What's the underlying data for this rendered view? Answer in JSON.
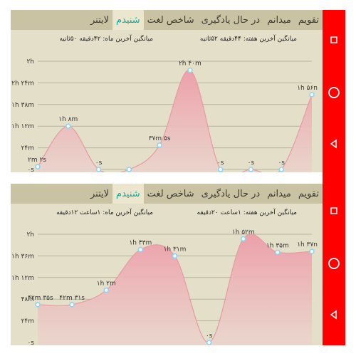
{
  "tabs": [
    "تقویم",
    "میدانم",
    "در حال یادگیری",
    "شاخص لغت",
    "شنیدم",
    "لایتنر"
  ],
  "active_tab": "شنیدم",
  "screens": [
    {
      "avg_week": "میانگین آخرین هفته: ۴۴دقیقه ۵۲ثانیه",
      "avg_month": "میانگین آخرین ماه: ۴۲دقیقه ۵۰ثانیه"
    },
    {
      "avg_week": "میانگین آخرین هفته: ۱ساعت ۲۰دقیقه",
      "avg_month": "میانگین آخرین ماه: ۱ساعت ۱۲دقیقه"
    }
  ],
  "nav": {
    "icons": [
      "recents-square-icon",
      "home-circle-icon",
      "back-triangle-icon"
    ]
  },
  "colors": {
    "accent": "#1aa89b",
    "nav_bar": "#ff0000",
    "fill": "#f2a3ad",
    "point": "#8fd3f5"
  },
  "chart_data": [
    {
      "type": "area",
      "ylim": [
        0,
        120
      ],
      "y_unit": "minutes",
      "yticks": [
        0,
        24,
        48,
        72,
        96,
        120
      ],
      "ytick_labels": [
        "۰s",
        "۲۴m",
        "۱h ۱۲m",
        "۱h ۳۸m",
        "۲h ۲۴m",
        "۲h"
      ],
      "values": [
        3,
        48,
        0,
        0,
        27,
        110,
        0,
        0,
        0,
        83
      ],
      "point_labels": [
        "۲m ۲s",
        "۱h ۸m",
        "۰s",
        "",
        "۳۷m ۵s",
        "۲h ۴۰m",
        "۰s",
        "۰s",
        "۰s",
        "۱h ۵۶n"
      ]
    },
    {
      "type": "area",
      "ylim": [
        0,
        120
      ],
      "y_unit": "minutes",
      "yticks": [
        0,
        24,
        48,
        72,
        96,
        120
      ],
      "ytick_labels": [
        "۰s",
        "۲۴m",
        "۴۸m",
        "۱h ۱۲m",
        "۱h ۳۶m",
        "۲h"
      ],
      "values": [
        42,
        42,
        58,
        103,
        96,
        0,
        115,
        100,
        101
      ],
      "point_labels": [
        "۴۲m ۳۵s",
        "۴۲m ۳۱s",
        "۱h ۲m",
        "۱h ۴۳m",
        "۱h ۳۱m",
        "۰s",
        "۱h ۵۲m",
        "۱h ۳۵m",
        "۱h ۳۷n"
      ]
    }
  ]
}
